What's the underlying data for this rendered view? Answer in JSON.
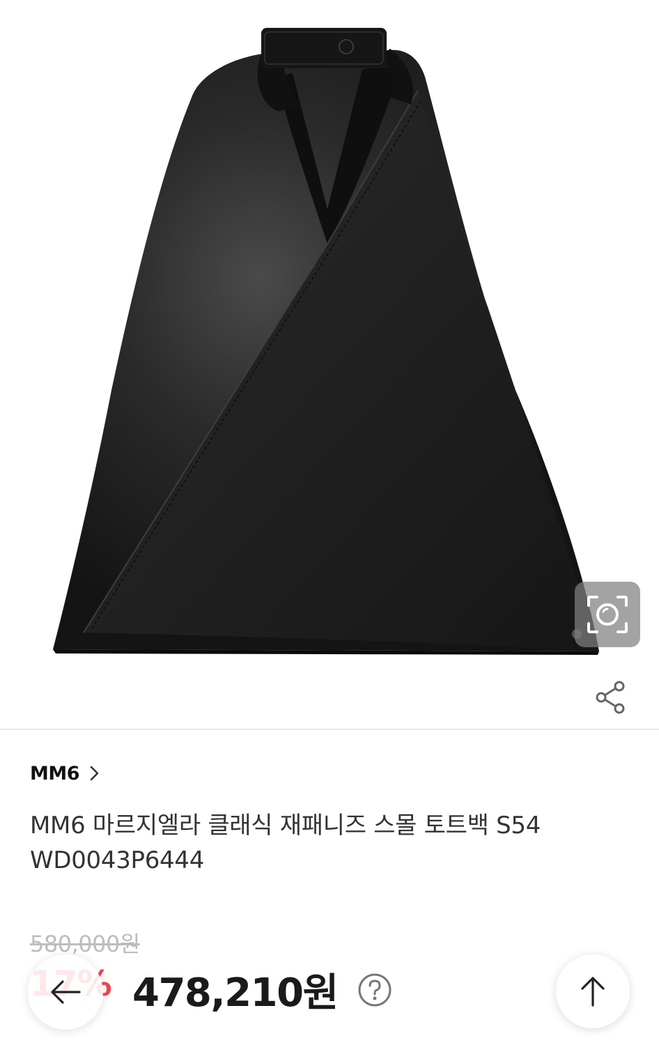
{
  "product": {
    "brand": "MM6",
    "title": "MM6 마르지엘라 클래식 재패니즈 스몰 토트백 S54 WD0043P6444",
    "original_price": "580,000원",
    "discount_rate": "17%",
    "sale_price": "478,210원"
  },
  "icons": {
    "lens": "camera-search-icon",
    "share": "share-icon",
    "brand_chevron": "chevron-right-icon",
    "price_info": "question-circle-icon",
    "back": "arrow-left-icon",
    "scroll_top": "arrow-up-icon"
  },
  "colors": {
    "discount": "#f2444e",
    "price": "#1a1a1a",
    "original_price": "#bdbdbd",
    "bag": "#1c1c1c"
  }
}
